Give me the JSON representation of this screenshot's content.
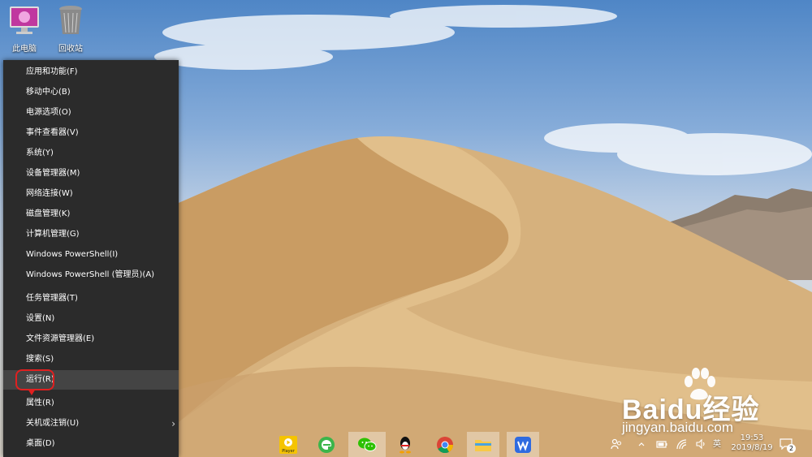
{
  "desktop": {
    "icons": [
      {
        "label": "此电脑",
        "icon": "computer-monitor-icon"
      },
      {
        "label": "回收站",
        "icon": "recycle-bin-icon"
      }
    ]
  },
  "winx_menu": {
    "items": [
      {
        "label": "应用和功能(F)"
      },
      {
        "label": "移动中心(B)"
      },
      {
        "label": "电源选项(O)"
      },
      {
        "label": "事件查看器(V)"
      },
      {
        "label": "系统(Y)"
      },
      {
        "label": "设备管理器(M)"
      },
      {
        "label": "网络连接(W)"
      },
      {
        "label": "磁盘管理(K)"
      },
      {
        "label": "计算机管理(G)"
      },
      {
        "label": "Windows PowerShell(I)"
      },
      {
        "label": "Windows PowerShell (管理员)(A)"
      },
      {
        "label": "任务管理器(T)"
      },
      {
        "label": "设置(N)"
      },
      {
        "label": "文件资源管理器(E)"
      },
      {
        "label": "搜索(S)"
      },
      {
        "label": "运行(R)"
      },
      {
        "label": "属性(R)"
      },
      {
        "label": "关机或注销(U)"
      },
      {
        "label": "桌面(D)"
      }
    ],
    "highlighted_item": "运行(R)",
    "submenu_chevron": "›"
  },
  "taskbar": {
    "apps": [
      {
        "name": "player-app",
        "label": "Player"
      },
      {
        "name": "browser-app"
      },
      {
        "name": "wechat-app"
      },
      {
        "name": "qq-app"
      },
      {
        "name": "chrome-app"
      },
      {
        "name": "file-explorer-app"
      },
      {
        "name": "wps-app"
      }
    ],
    "tray": {
      "ime": "英",
      "time": "19:53",
      "date": "2019/8/19",
      "notification_count": "2"
    }
  },
  "watermark": {
    "brand": "Baidu经验",
    "url": "jingyan.baidu.com"
  },
  "colors": {
    "menu_bg": "#2b2b2b",
    "menu_hover": "#444444",
    "highlight_ring": "#e02020"
  }
}
